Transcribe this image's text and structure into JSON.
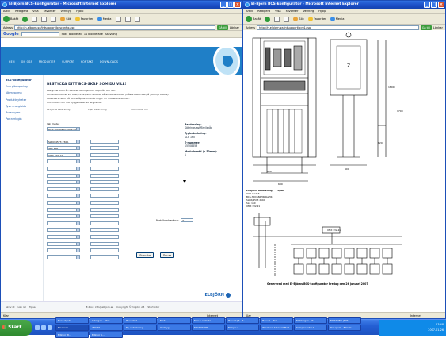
{
  "left_window": {
    "title": "El-Björn BCS-konfigurator - Microsoft Internet Explorer",
    "menu": [
      "Arkiv",
      "Redigera",
      "Visa",
      "Favoriter",
      "Verktyg",
      "Hjälp"
    ],
    "toolbar": {
      "back": "Bakåt",
      "search": "Sök",
      "favorites": "Favoriter",
      "media": "Media"
    },
    "address_label": "Adress",
    "address": "http://n-elbjorn.se/Intsupport/bcsconfig.asp",
    "go_label": "Gå till",
    "links_label": "Länkar",
    "google_bar": {
      "logo": "Google",
      "search_button": "Sök",
      "extras": [
        "Blockerat",
        "11 blockerade",
        "Stavning"
      ]
    },
    "site": {
      "nav": [
        "HEM",
        "OM OSS",
        "PRODUKTER",
        "SUPPORT",
        "KONTAKT",
        "DOWNLOADS"
      ],
      "sidenav": [
        "BCS-konfigurator",
        "Energibesparing",
        "Värmepump",
        "Produktnyheter",
        "Tysk energisida",
        "Broschyrer",
        "Partnerlogin"
      ],
      "heading": "BESTYCKA DITT BCS-SKÅP SOM DU VILL!",
      "intro": [
        "Bestyckel ditt från vänster till höger och uppifrån och ner.",
        "Om en elflöderas vid bestyckningens moduler så används dit fält (måste beskrivas på ytterligt bättre).",
        "Observera fällor på BCS-skåpets innehåll avgör för modellens storlek.",
        "Information om ditt bygge beskrivs längre ner."
      ],
      "col_headers": [
        "Ell-Björns beteckning",
        "Egen beteckning",
        "Information om"
      ],
      "vald_modul_label": "Vald modell",
      "selects": [
        "BCS-700/AN1H4NG2H4",
        "SLDX/4573 250A",
        "SLX 160",
        "UMX 332-21"
      ],
      "info": {
        "benamning_label": "Benämning:",
        "benamning_value": "Säkringslast/Bryllskåp",
        "typ_label": "Typbeteckning:",
        "typ_value": "SLX 160",
        "enummer_label": "E-nummer:",
        "enummer_value": "15508653",
        "modul_label": "Modulbredd (x 50mm):",
        "modul_value": "1"
      },
      "modulbredd_label": "Modulbredder kvar:",
      "modulbredd_value": "0",
      "btn_granska": "Granska",
      "btn_rensa": "Rensa",
      "footer": [
        "E-Post: info@elbjorn.se",
        "Copyright ©El-Björn AB",
        "Startsidor"
      ],
      "footer_left": [
        "Skriv ut",
        "Län rel",
        "Tipsa"
      ],
      "brand": "ELBJÖRN"
    },
    "status": "Klar",
    "zone": "Internet"
  },
  "right_window": {
    "title": "El-Björn BCS-konfigurator - Microsoft Internet Explorer",
    "menu": [
      "Arkiv",
      "Redigera",
      "Visa",
      "Favoriter",
      "Verktyg",
      "Hjälp"
    ],
    "toolbar": {
      "back": "Bakåt",
      "search": "Sök",
      "favorites": "Favoriter",
      "media": "Media"
    },
    "address_label": "Adress",
    "address": "http://n-elbjorn.se/Intsupport/bcs4.asp",
    "go_label": "Gå till",
    "links_label": "Länkar",
    "doc": {
      "dim_top": "900",
      "dim_mid": "900",
      "dim_right_1": "1800",
      "dim_right_2": "1700",
      "dim_right_3": "620",
      "dim_bottom": "680",
      "z_label": "Z",
      "list_header": [
        "El-Björns beteckning",
        "Egen"
      ],
      "list_items": [
        "Vald modell:",
        "BCS-700/AN1H4NG2H4",
        "SLDX/4573 250A",
        "SLX 160",
        "UMX 332-21"
      ],
      "umx": "UMX 332-21",
      "footer": "Genererad med El-Björns BCS-konfigurator Fredag den 26 januari 2007"
    },
    "status": "Klar",
    "zone": "Internet"
  },
  "taskbar": {
    "start": "Start",
    "tasks": [
      "Bank Syste...",
      "Inkorgen - Micr...",
      "Huvudsid...",
      "Medd...",
      "Micr.n.ordaste",
      "Huvud:p4 - A:...",
      "Huvud - Micr...",
      "Motkorgen - lä",
      "MOSRVER (SYS)",
      "Blockera",
      "ANDSII",
      "Ny anteckning",
      "Verktyg...",
      "MICROSOFT",
      "Ellinjor 2...",
      "Windows Autowet Mod...",
      "Komponenter S...",
      "Dat.ipal2 - Ellinda...",
      "Ellinjor 8I...",
      "Ellinjor K..."
    ],
    "time": "13:48",
    "date": "2007-01-26"
  }
}
